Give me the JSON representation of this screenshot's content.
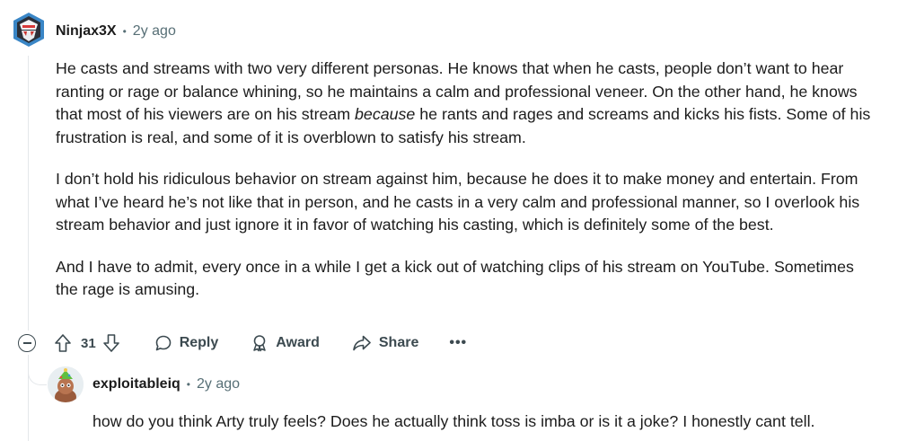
{
  "comment": {
    "author": "Ninjax3X",
    "time": "2y ago",
    "paragraphs": [
      {
        "before": "He casts and streams with two very different personas. He knows that when he casts, people don’t want to hear ranting or rage or balance whining, so he maintains a calm and professional veneer. On the other hand, he knows that most of his viewers are on his stream ",
        "emphasis": "because",
        "after": " he rants and rages and screams and kicks his fists. Some of his frustration is real, and some of it is overblown to satisfy his stream."
      },
      {
        "text": "I don’t hold his ridiculous behavior on stream against him, because he does it to make money and entertain. From what I’ve heard he’s not like that in person, and he casts in a very calm and professional manner, so I overlook his stream behavior and just ignore it in favor of watching his casting, which is definitely some of the best."
      },
      {
        "text": "And I have to admit, every once in a while I get a kick out of watching clips of his stream on YouTube. Sometimes the rage is amusing."
      }
    ],
    "score": "31",
    "actions": {
      "reply": "Reply",
      "award": "Award",
      "share": "Share",
      "more": "•••"
    }
  },
  "reply_comment": {
    "author": "exploitableiq",
    "time": "2y ago",
    "text": "how do you think Arty truly feels? Does he actually think toss is imba or is it a joke? I honestly cant tell."
  },
  "colors": {
    "text": "#1c1c1c",
    "meta": "#576f76",
    "action": "#3c4a50",
    "thread": "#e4e7ea"
  },
  "icons": [
    "ninjax-avatar-icon",
    "collapse-icon",
    "upvote-icon",
    "downvote-icon",
    "reply-icon",
    "award-icon",
    "share-icon",
    "more-icon",
    "exploitableiq-avatar-icon"
  ]
}
